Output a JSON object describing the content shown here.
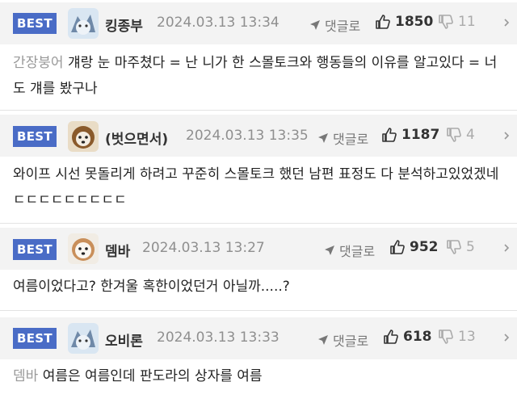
{
  "comments": [
    {
      "badge": "BEST",
      "nickname": "킹종부",
      "date": "2024.03.13 13:34",
      "reply_label": "댓글로",
      "likes": "1850",
      "dislikes": "11",
      "reply_to": "간장붕어",
      "text": "걔랑 눈 마주쳤다 = 난 니가 한 스몰토크와 행동들의 이유를 알고있다 = 너도 걔를 봤구나"
    },
    {
      "badge": "BEST",
      "nickname": "(벗으면서)",
      "date": "2024.03.13 13:35",
      "reply_label": "댓글로",
      "likes": "1187",
      "dislikes": "4",
      "reply_to": "",
      "text": "와이프 시선 못돌리게 하려고 꾸준히 스몰토크 했던 남편 표정도 다 분석하고있었겠네 ㄷㄷㄷㄷㄷㄷㄷㄷㄷ"
    },
    {
      "badge": "BEST",
      "nickname": "뎀바",
      "date": "2024.03.13 13:27",
      "reply_label": "댓글로",
      "likes": "952",
      "dislikes": "5",
      "reply_to": "",
      "text": "여름이었다고? 한겨울 혹한이었던거 아닐까.....?"
    },
    {
      "badge": "BEST",
      "nickname": "오비론",
      "date": "2024.03.13 13:33",
      "reply_label": "댓글로",
      "likes": "618",
      "dislikes": "13",
      "reply_to": "뎀바",
      "text": "여름은 여름인데 판도라의 상자를 여름"
    }
  ],
  "colors": {
    "badge": "#4a6cc6",
    "header_bg": "#f3f3f3",
    "date": "#8f8f8f",
    "dislike": "#aaaaaa"
  },
  "icons": {
    "reply": "reply-arrow-icon",
    "like": "thumbs-up-icon",
    "dislike": "thumbs-down-icon",
    "more": "chevron-right-icon"
  }
}
